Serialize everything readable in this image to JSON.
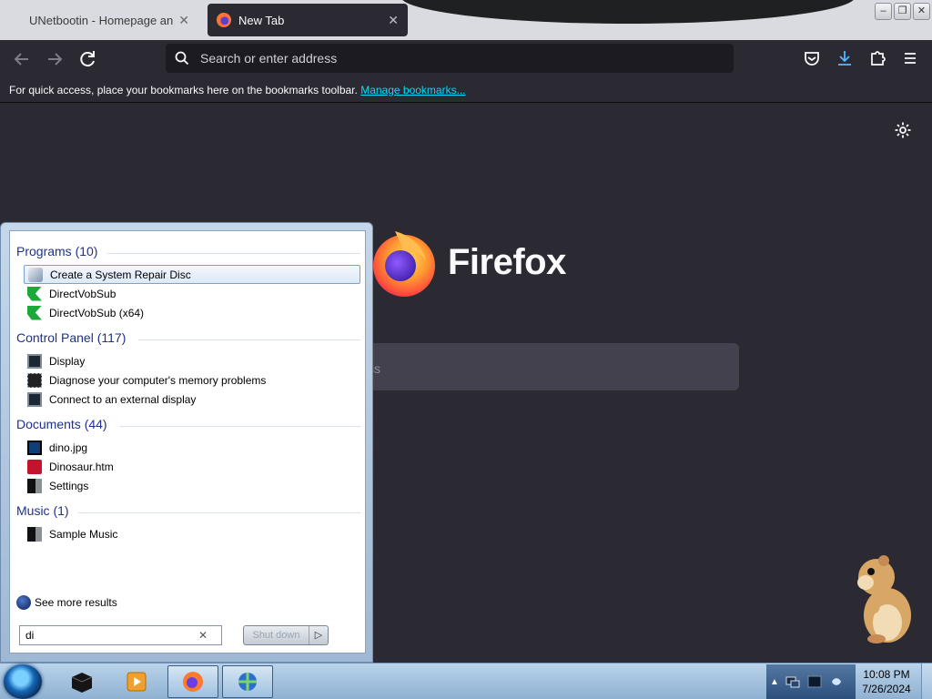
{
  "browser": {
    "tabs": [
      {
        "title": "UNetbootin - Homepage and D",
        "close": "✕"
      },
      {
        "title": "New Tab",
        "close": "✕"
      }
    ],
    "window_controls": {
      "minimize": "–",
      "restore": "❐",
      "close": "✕"
    },
    "address_placeholder": "Search or enter address",
    "bookmarks_hint": "For quick access, place your bookmarks here on the bookmarks toolbar.",
    "manage_bookmarks": "Manage bookmarks...",
    "wordmark": "Firefox",
    "search_partial": "ss"
  },
  "start_menu": {
    "groups": [
      {
        "label": "Programs (10)",
        "items": [
          {
            "label": "Create a System Repair Disc",
            "icon": "repair-disc-icon",
            "selected": true
          },
          {
            "label": "DirectVobSub",
            "icon": "directvobsub-icon"
          },
          {
            "label": "DirectVobSub (x64)",
            "icon": "directvobsub-icon"
          }
        ]
      },
      {
        "label": "Control Panel (117)",
        "items": [
          {
            "label": "Display",
            "icon": "display-icon"
          },
          {
            "label": "Diagnose your computer's memory problems",
            "icon": "memory-icon"
          },
          {
            "label": "Connect to an external display",
            "icon": "display-icon"
          }
        ]
      },
      {
        "label": "Documents (44)",
        "items": [
          {
            "label": "dino.jpg",
            "icon": "image-file-icon"
          },
          {
            "label": "Dinosaur.htm",
            "icon": "html-file-icon"
          },
          {
            "label": "Settings",
            "icon": "folder-icon"
          }
        ]
      },
      {
        "label": "Music (1)",
        "items": [
          {
            "label": "Sample Music",
            "icon": "folder-icon"
          }
        ]
      }
    ],
    "see_more": "See more results",
    "search_value": "di",
    "clear": "✕",
    "shutdown_label": "Shut down",
    "shutdown_arrow": "▷"
  },
  "taskbar": {
    "time": "10:08 PM",
    "date": "7/26/2024",
    "tray_expand": "▲"
  },
  "colors": {
    "browser_bg": "#2b2a33",
    "link": "#00ddff",
    "group_heading": "#1e3287",
    "taskbar": "#9fbfdd"
  }
}
